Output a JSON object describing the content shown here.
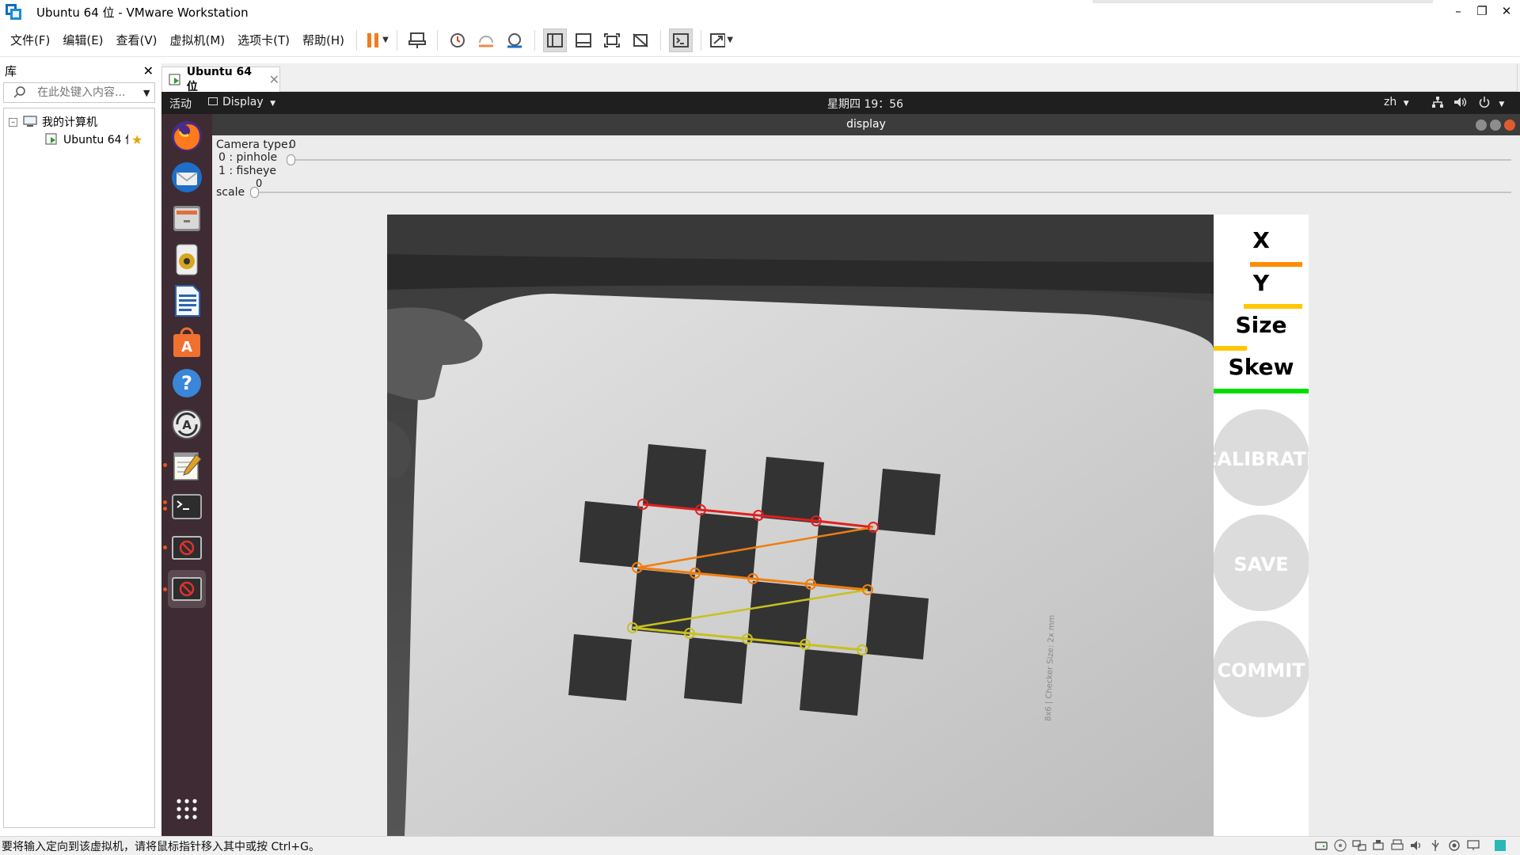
{
  "window": {
    "title": "Ubuntu 64 位 - VMware Workstation"
  },
  "menu": [
    "文件(F)",
    "编辑(E)",
    "查看(V)",
    "虚拟机(M)",
    "选项卡(T)",
    "帮助(H)"
  ],
  "library": {
    "title": "库",
    "search_placeholder": "在此处键入内容...",
    "tree_root": "我的计算机",
    "tree_child": "Ubuntu 64 位"
  },
  "tab": {
    "label": "Ubuntu 64 位"
  },
  "gnome": {
    "activities": "活动",
    "app_menu": "Display",
    "clock": "星期四 19：56",
    "input_method": "zh"
  },
  "app": {
    "title": "display",
    "camera_type_label": "Camera type:",
    "camera_option_0": "0 : pinhole",
    "camera_option_1": "1 : fisheye",
    "camera_type_value": "0",
    "scale_label": "scale",
    "scale_value": "0"
  },
  "calib_panel": {
    "x_label": "X",
    "y_label": "Y",
    "size_label": "Size",
    "skew_label": "Skew",
    "x_progress": 0.55,
    "y_progress": 0.62,
    "size_progress": 0.35,
    "skew_progress": 1.0,
    "x_color": "#ff8c00",
    "y_color": "#ffc800",
    "size_color": "#ffc800",
    "skew_color": "#00dd00",
    "calibrate_button": "CALIBRATE",
    "save_button": "SAVE",
    "commit_button": "COMMIT"
  },
  "status": {
    "message": "要将输入定向到该虚拟机，请将鼠标指针移入其中或按 Ctrl+G。"
  }
}
